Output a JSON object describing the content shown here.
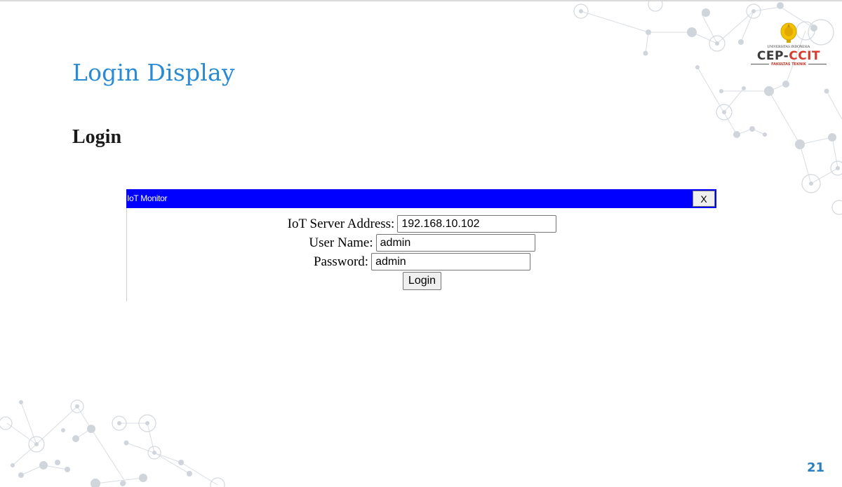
{
  "slide": {
    "title": "Login Display",
    "subtitle": "Login",
    "page_number": "21",
    "title_color": "#2a8bd3"
  },
  "logo": {
    "university": "UNIVERSITAS INDONESIA",
    "brand_left": "CEP-",
    "brand_right": "CCIT",
    "faculty": "FAKULTAS TEKNIK",
    "emblem_icon": "makara-emblem-icon"
  },
  "window": {
    "title": "IoT Monitor",
    "close_label": "X",
    "titlebar_color": "#0000ff"
  },
  "form": {
    "server_label": "IoT Server Address:",
    "server_value": "192.168.10.102",
    "username_label": "User Name:",
    "username_value": "admin",
    "password_label": "Password:",
    "password_value": "admin",
    "login_label": "Login"
  }
}
